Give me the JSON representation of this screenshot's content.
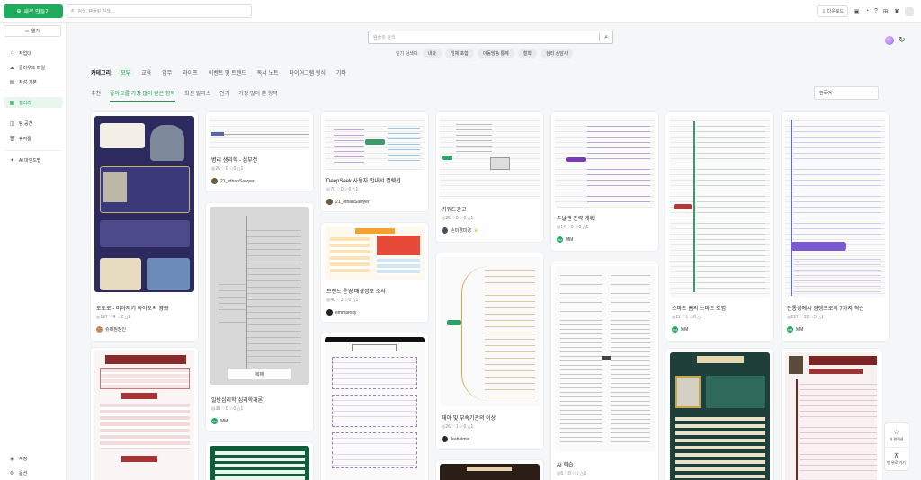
{
  "header": {
    "new_label": "새로 만들기",
    "search_placeholder": "검색, 템플릿 검색...",
    "download_label": "다운로드",
    "icons": [
      "doc-icon",
      "bell-icon",
      "help-icon",
      "apps-icon",
      "gift-icon"
    ]
  },
  "sidebar": {
    "open_label": "열기",
    "items": [
      {
        "label": "작업대",
        "icon": "desk-icon"
      },
      {
        "label": "클라우드 파일",
        "icon": "cloud-icon"
      },
      {
        "label": "작성 기본",
        "icon": "file-icon"
      },
      {
        "label": "갤러리",
        "icon": "gallery-icon",
        "active": true
      },
      {
        "label": "팀 공간",
        "icon": "team-icon"
      },
      {
        "label": "휴지통",
        "icon": "trash-icon"
      },
      {
        "label": "AI 마인드맵",
        "icon": "ai-icon"
      }
    ],
    "bottom": [
      {
        "label": "계정",
        "icon": "user-icon"
      },
      {
        "label": "옵션",
        "icon": "settings-icon"
      }
    ]
  },
  "main": {
    "search_placeholder": "템플릿 검색",
    "popular_label": "인기 검색어:",
    "popular_tags": [
      "내과",
      "일체 포함",
      "이동방송 통계",
      "철학",
      "심리 상담사"
    ],
    "category_label": "카테고리:",
    "categories": [
      "모두",
      "교육",
      "업무",
      "라이프",
      "이벤트 및 트렌드",
      "독서 노트",
      "다이어그램 형식",
      "기타"
    ],
    "tabs": [
      "추천",
      "좋아요를 가장 많이 받은 항목",
      "최신 릴리스",
      "인기",
      "가장 많이 본 항목"
    ],
    "language": "한국어",
    "copy_label": "복제"
  },
  "cards": [
    {
      "title": "토토로 - 미야자키 하야오의 영화",
      "stats": "◎197 ♡4 ☆2 △2",
      "author": "슈퍼짐장인"
    },
    {
      "title": "병리 생리학 - 심부전",
      "stats": "◎26 ♡0 ☆0 △1",
      "author": "21_ethanSawyer"
    },
    {
      "title": "일반심리학(심리학개론)",
      "stats": "◎38 ♡0 ☆0 △1",
      "author": "MM"
    },
    {
      "title": "DeepSeek 사용자 안내서 컬렉션",
      "stats": "◎70 ♡0 ☆0 △1",
      "author": "21_ethanSawyer"
    },
    {
      "title": "브랜드 운영 배경정보 조사",
      "stats": "◎40 ♡3 ☆0 △1",
      "author": "emmarosy"
    },
    {
      "title": "키워드광고",
      "stats": "◎25 ♡0 ☆0 △1",
      "author": "손미경미경"
    },
    {
      "title": "태아 및 부속기관의 이상",
      "stats": "◎26 ♡1 ☆0 △1",
      "author": "Isabelmia"
    },
    {
      "title": "두날랜 전략 계획",
      "stats": "◎14 ♡0 ☆0 △1",
      "author": "MM"
    },
    {
      "title": "AI 학습",
      "stats": "◎5 ♡0 ☆0 △0",
      "author": ""
    },
    {
      "title": "스마트 홈의 스마트 조명",
      "stats": "◎11 ♡1 ☆0 △1",
      "author": "MM"
    },
    {
      "title": "전통성에서 경쟁으로의 7가지 혁신",
      "stats": "◎217 ♡12 ☆5 △1",
      "author": "MM"
    }
  ],
  "float_tools": [
    "내 컬렉션",
    "맨 위로 가기"
  ]
}
